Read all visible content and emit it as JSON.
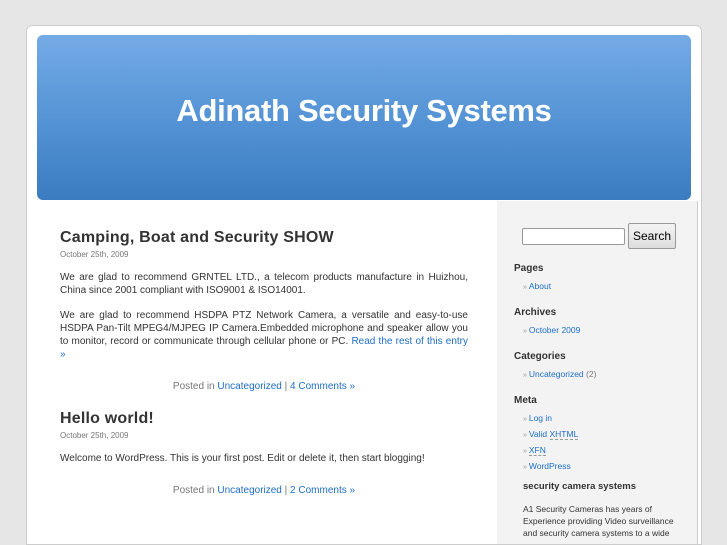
{
  "site_title": "Adinath Security Systems",
  "posts": [
    {
      "title": "Camping, Boat and Security SHOW",
      "date": "October 25th, 2009",
      "paragraphs": [
        "We are glad to recommend GRNTEL LTD., a telecom products manufacture in Huizhou, China since 2001 compliant with ISO9001 & ISO14001.",
        "We are glad to recommend HSDPA PTZ Network Camera, a versatile and easy-to-use HSDPA Pan-Tilt MPEG4/MJPEG IP Camera.Embedded microphone and speaker allow you to monitor, record or communicate through cellular phone or PC."
      ],
      "read_more": "Read the rest of this entry »",
      "posted_in": "Posted in",
      "category": "Uncategorized",
      "sep": "|",
      "comments": "4 Comments »"
    },
    {
      "title": "Hello world!",
      "date": "October 25th, 2009",
      "paragraphs": [
        "Welcome to WordPress. This is your first post. Edit or delete it, then start blogging!"
      ],
      "posted_in": "Posted in",
      "category": "Uncategorized",
      "sep": "|",
      "comments": "2 Comments »"
    }
  ],
  "sidebar": {
    "search_value": "",
    "search_button": "Search",
    "pages_title": "Pages",
    "pages": [
      "About"
    ],
    "archives_title": "Archives",
    "archives": [
      "October 2009"
    ],
    "categories_title": "Categories",
    "categories": [
      {
        "name": "Uncategorized",
        "count": "(2)"
      }
    ],
    "meta_title": "Meta",
    "meta": {
      "login": "Log in",
      "valid": "Valid",
      "xhtml": "XHTML",
      "xfn": "XFN",
      "wordpress": "WordPress"
    },
    "widget_title": "security camera systems",
    "widget_text": "A1 Security Cameras has years of Experience providing Video surveillance and security camera systems to a wide"
  }
}
